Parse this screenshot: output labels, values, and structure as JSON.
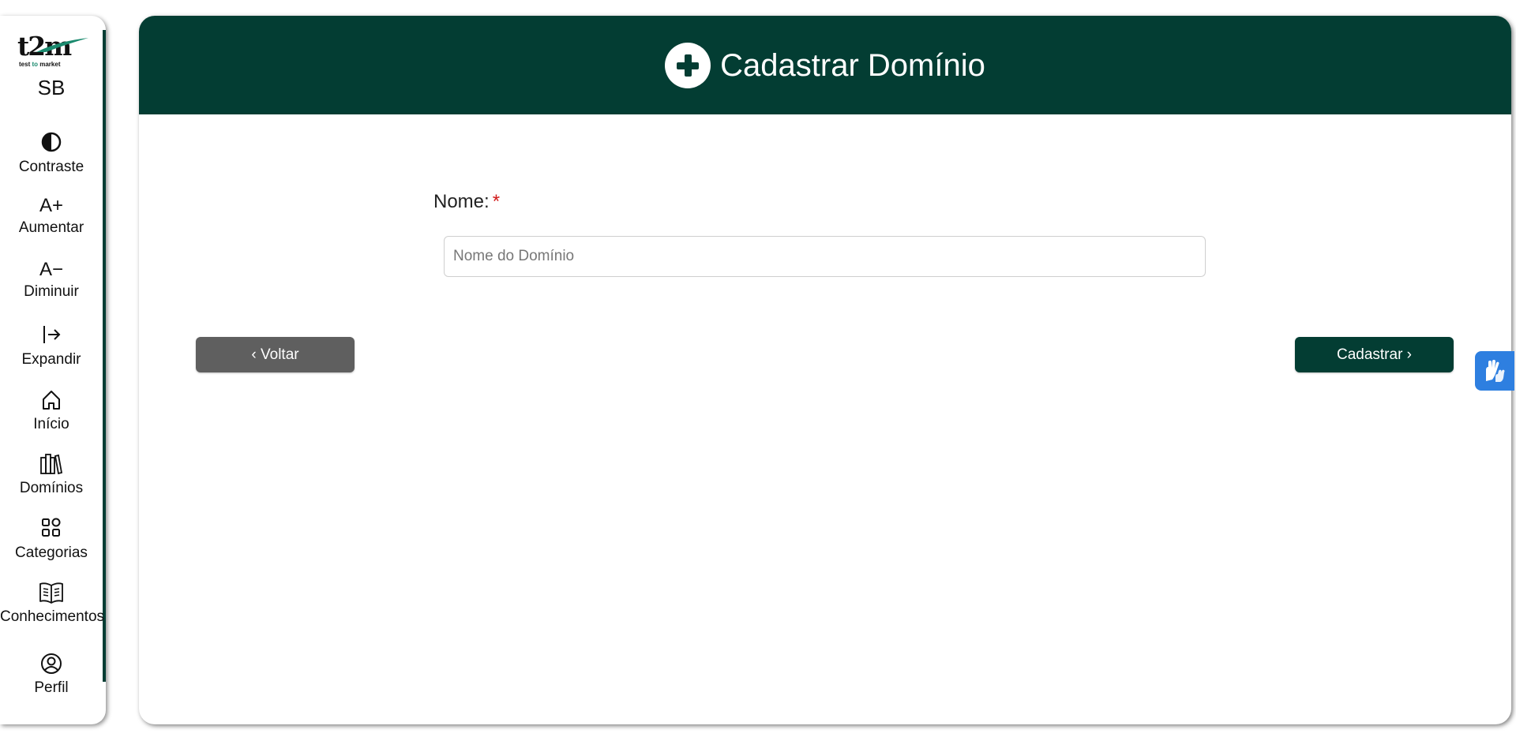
{
  "sidebar": {
    "logo": {
      "mark": "t2m",
      "tagline_before": "test ",
      "tagline_to": "to",
      "tagline_after": " market"
    },
    "initials": "SB",
    "items": [
      {
        "label": "Contraste",
        "icon": "contrast-icon"
      },
      {
        "label": "Aumentar",
        "icon": "a-plus-icon",
        "glyph": "A+"
      },
      {
        "label": "Diminuir",
        "icon": "a-minus-icon",
        "glyph": "A−"
      },
      {
        "label": "Expandir",
        "icon": "expand-arrow-icon"
      },
      {
        "label": "Início",
        "icon": "home-icon"
      },
      {
        "label": "Domínios",
        "icon": "books-icon"
      },
      {
        "label": "Categorias",
        "icon": "grid-icon"
      },
      {
        "label": "Conhecimentos",
        "icon": "book-icon"
      },
      {
        "label": "Perfil",
        "icon": "user-circle-icon"
      }
    ]
  },
  "header": {
    "title": "Cadastrar Domínio",
    "icon": "plus-circle-icon"
  },
  "form": {
    "name_label": "Nome:",
    "required_mark": "*",
    "name_value": "",
    "name_placeholder": "Nome do Domínio"
  },
  "actions": {
    "back_label": "‹ Voltar",
    "submit_label": "Cadastrar ›"
  },
  "colors": {
    "primary": "#033d33",
    "secondary_button": "#5f5f5f",
    "required": "#d11a1a",
    "accessibility_widget": "#2e7fe0"
  },
  "widgets": {
    "accessibility_icon": "sign-language-hands-icon"
  }
}
